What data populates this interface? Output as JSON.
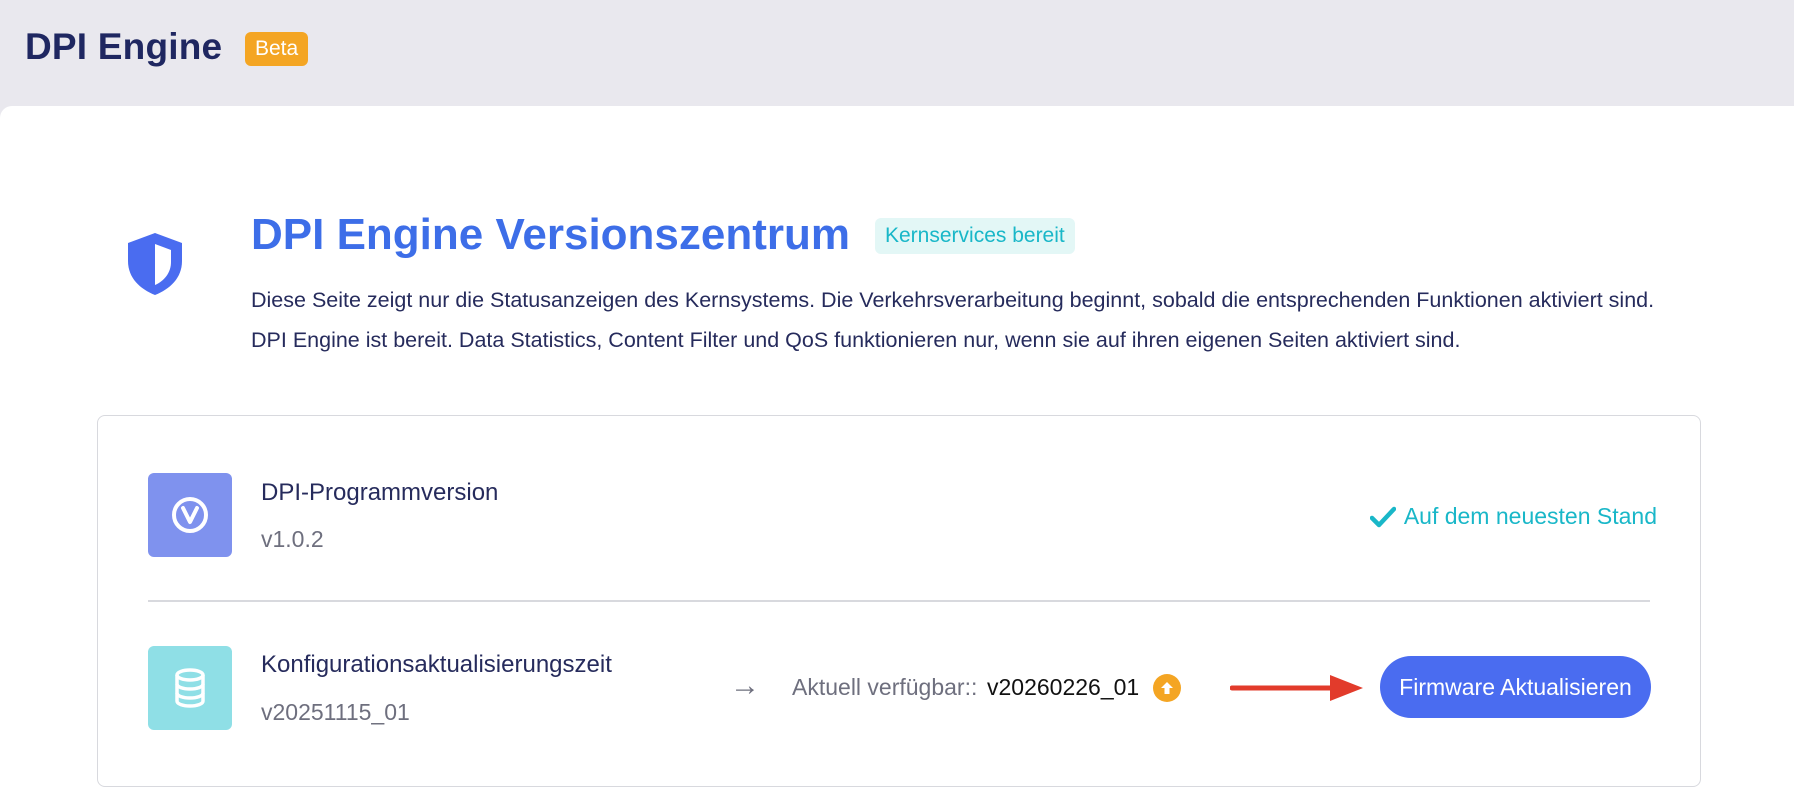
{
  "header": {
    "app_title": "DPI Engine",
    "beta_badge": "Beta"
  },
  "hero": {
    "title": "DPI Engine Versionszentrum",
    "status_badge": "Kernservices bereit",
    "description_line1": "Diese Seite zeigt nur die Statusanzeigen des Kernsystems. Die Verkehrsverarbeitung beginnt, sobald die entsprechenden Funktionen aktiviert sind.",
    "description_line2": "DPI Engine ist bereit. Data Statistics, Content Filter und QoS funktionieren nur, wenn sie auf ihren eigenen Seiten aktiviert sind."
  },
  "program_version": {
    "label": "DPI-Programmversion",
    "value": "v1.0.2",
    "status": "Auf dem neuesten Stand",
    "icon": "version-check-icon"
  },
  "config_update": {
    "label": "Konfigurationsaktualisierungszeit",
    "value": "v20251115_01",
    "arrow": "→",
    "available_label": "Aktuell verfügbar::",
    "available_value": "v20260226_01",
    "button_label": "Firmware Aktualisieren",
    "icon": "database-icon"
  },
  "colors": {
    "accent": "#4a6cf0",
    "title_blue": "#3d6ee8",
    "teal": "#19b7c8",
    "beta_orange": "#f4a523",
    "annotation_red": "#e23b2b"
  }
}
